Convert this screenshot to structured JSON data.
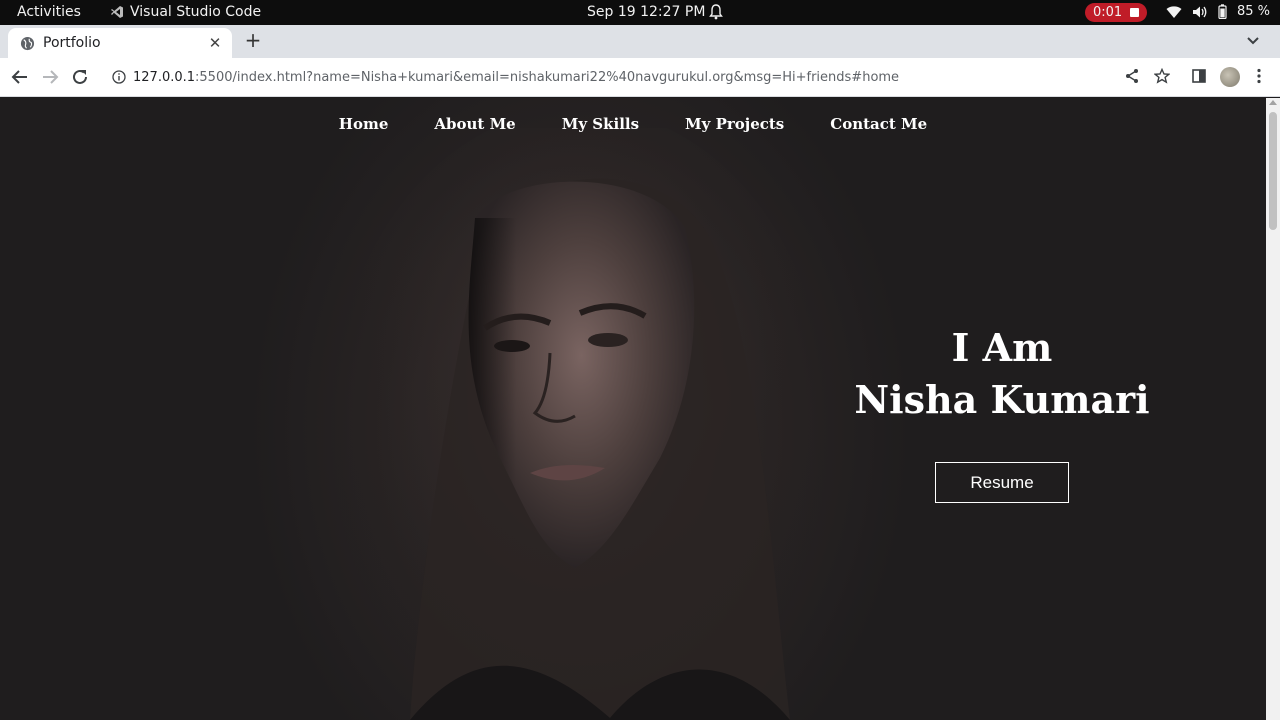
{
  "system_bar": {
    "activities": "Activities",
    "app_name": "Visual Studio Code",
    "clock": "Sep 19  12:27 PM",
    "recording_time": "0:01",
    "battery": "85 %"
  },
  "browser": {
    "tab_title": "Portfolio",
    "url_host": "127.0.0.1",
    "url_rest": ":5500/index.html?name=Nisha+kumari&email=nishakumari22%40navgurukul.org&msg=Hi+friends#home"
  },
  "page": {
    "nav": [
      "Home",
      "About Me",
      "My Skills",
      "My Projects",
      "Contact Me"
    ],
    "hero_line1": "I Am",
    "hero_line2": "Nisha Kumari",
    "resume_label": "Resume"
  },
  "colors": {
    "page_bg": "#1f1d1e",
    "recording": "#c01c28",
    "text": "#ffffff"
  }
}
